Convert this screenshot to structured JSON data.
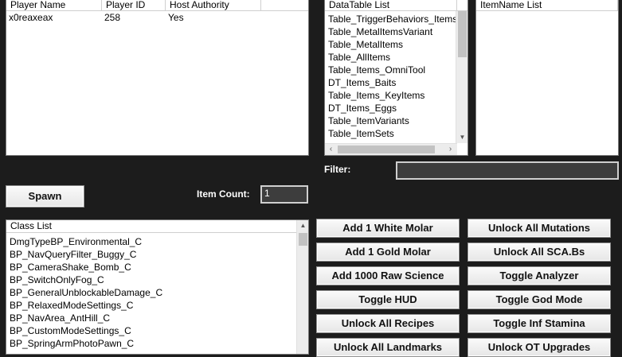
{
  "players": {
    "columns": [
      "Player Name",
      "Player ID",
      "Host Authority"
    ],
    "rows": [
      [
        "x0reaxeax",
        "258",
        "Yes"
      ]
    ]
  },
  "datatable": {
    "header": "DataTable List",
    "items": [
      "Table_TriggerBehaviors_Items",
      "Table_MetalItemsVariant",
      "Table_MetalItems",
      "Table_AllItems",
      "Table_Items_OmniTool",
      "DT_Items_Baits",
      "Table_Items_KeyItems",
      "DT_Items_Eggs",
      "Table_ItemVariants",
      "Table_ItemSets"
    ]
  },
  "itemnames": {
    "header": "ItemName List"
  },
  "filter": {
    "label": "Filter:",
    "value": ""
  },
  "spawn": {
    "label": "Spawn"
  },
  "item_count": {
    "label": "Item Count:",
    "value": "1"
  },
  "classlist": {
    "header": "Class List",
    "items": [
      "DmgTypeBP_Environmental_C",
      "BP_NavQueryFilter_Buggy_C",
      "BP_CameraShake_Bomb_C",
      "BP_SwitchOnlyFog_C",
      "BP_GeneralUnblockableDamage_C",
      "BP_RelaxedModeSettings_C",
      "BP_NavArea_AntHill_C",
      "BP_CustomModeSettings_C",
      "BP_SpringArmPhotoPawn_C"
    ]
  },
  "actions": {
    "col1": [
      "Add 1 White Molar",
      "Add 1 Gold Molar",
      "Add 1000 Raw Science",
      "Toggle HUD",
      "Unlock All Recipes",
      "Unlock All Landmarks"
    ],
    "col2": [
      "Unlock All Mutations",
      "Unlock All SCA.Bs",
      "Toggle Analyzer",
      "Toggle God Mode",
      "Toggle Inf Stamina",
      "Unlock OT Upgrades"
    ]
  }
}
